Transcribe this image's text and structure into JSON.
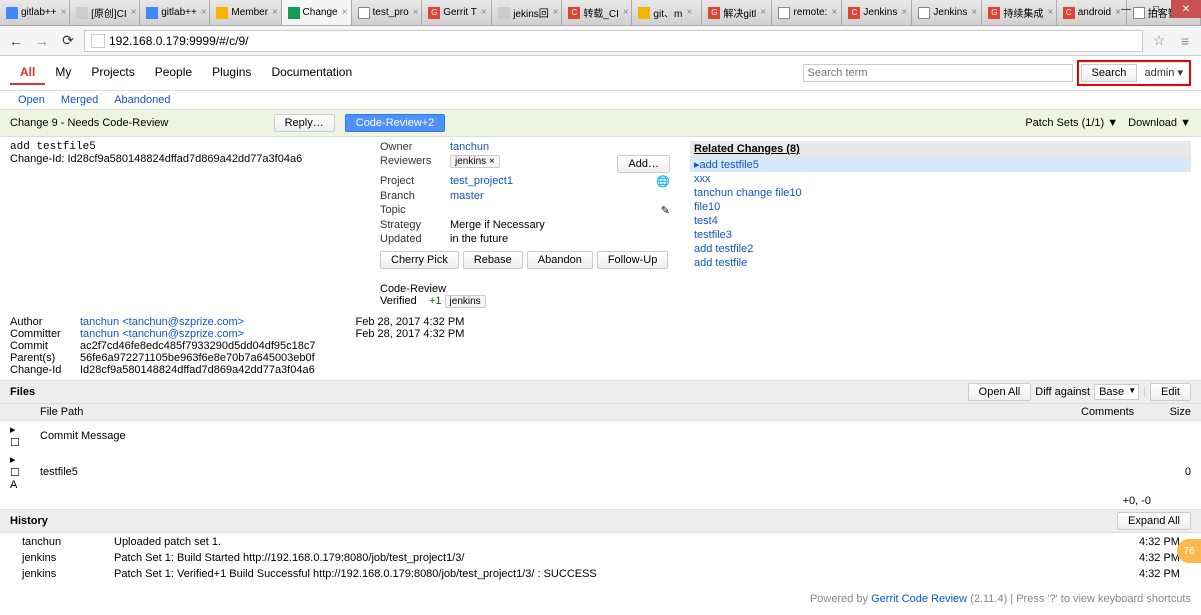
{
  "browser": {
    "tabs": [
      {
        "label": "gitlab++",
        "iconClass": "i-blue"
      },
      {
        "label": "[原创]CI",
        "iconClass": "i-gray"
      },
      {
        "label": "gitlab++",
        "iconClass": "i-blue"
      },
      {
        "label": "Member",
        "iconClass": "i-orange"
      },
      {
        "label": "Change",
        "iconClass": "i-green",
        "active": true
      },
      {
        "label": "test_pro",
        "iconClass": "i-doc"
      },
      {
        "label": "Gerrit T",
        "iconClass": "i-red",
        "badge": "G"
      },
      {
        "label": "jekins回",
        "iconClass": "i-gray"
      },
      {
        "label": "转载_CI",
        "iconClass": "i-red",
        "badge": "C"
      },
      {
        "label": "git、m",
        "iconClass": "i-orange"
      },
      {
        "label": "解决gitl",
        "iconClass": "i-red",
        "badge": "G"
      },
      {
        "label": "remote:",
        "iconClass": "i-doc"
      },
      {
        "label": "Jenkins",
        "iconClass": "i-red",
        "badge": "C"
      },
      {
        "label": "Jenkins",
        "iconClass": "i-doc"
      },
      {
        "label": "持续集成",
        "iconClass": "i-red",
        "badge": "G"
      },
      {
        "label": "android",
        "iconClass": "i-red",
        "badge": "C"
      },
      {
        "label": "拍客智能",
        "iconClass": "i-doc"
      }
    ],
    "url": "192.168.0.179:9999/#/c/9/"
  },
  "header": {
    "nav": [
      "All",
      "My",
      "Projects",
      "People",
      "Plugins",
      "Documentation"
    ],
    "activeNav": "All",
    "subnav": [
      "Open",
      "Merged",
      "Abandoned"
    ],
    "searchPlaceholder": "Search term",
    "searchBtn": "Search",
    "user": "admin ▾"
  },
  "change": {
    "barLeft": "Change 9 - Needs Code-Review",
    "subject": "add testfile5",
    "changeIdLabel": "Change-Id: ",
    "changeId": "Id28cf9a580148824dffad7d869a42dd77a3f04a6",
    "replyBtn": "Reply…",
    "crBtn": "Code-Review+2",
    "patchSets": "Patch Sets (1/1) ▼",
    "download": "Download ▼"
  },
  "info": {
    "owner": {
      "k": "Owner",
      "v": "tanchun"
    },
    "reviewers": {
      "k": "Reviewers",
      "v": "jenkins ×",
      "add": "Add…"
    },
    "project": {
      "k": "Project",
      "v": "test_project1"
    },
    "branch": {
      "k": "Branch",
      "v": "master"
    },
    "topic": {
      "k": "Topic",
      "v": ""
    },
    "strategy": {
      "k": "Strategy",
      "v": "Merge if Necessary"
    },
    "updated": {
      "k": "Updated",
      "v": "in the future"
    },
    "actions": [
      "Cherry Pick",
      "Rebase",
      "Abandon",
      "Follow-Up"
    ],
    "reviewLabel": "Code-Review",
    "verified": {
      "label": "Verified",
      "score": "+1",
      "user": "jenkins"
    }
  },
  "related": {
    "header": "Related Changes (8)",
    "items": [
      {
        "label": "add testfile5",
        "current": true
      },
      {
        "label": "xxx"
      },
      {
        "label": "tanchun change file10"
      },
      {
        "label": "file10"
      },
      {
        "label": "test4"
      },
      {
        "label": "testfile3"
      },
      {
        "label": "add testfile2"
      },
      {
        "label": "add testfile"
      }
    ]
  },
  "commit": {
    "author": {
      "k": "Author",
      "name": "tanchun",
      "email": "<tanchun@szprize.com>",
      "date": "Feb 28, 2017 4:32 PM"
    },
    "committer": {
      "k": "Committer",
      "name": "tanchun",
      "email": "<tanchun@szprize.com>",
      "date": "Feb 28, 2017 4:32 PM"
    },
    "commit": {
      "k": "Commit",
      "v": "ac2f7cd46fe8edc485f7933290d5dd04df95c18c7"
    },
    "parents": {
      "k": "Parent(s)",
      "v": "56fe6a972271105be963f6e8e70b7a645003eb0f"
    },
    "changeId": {
      "k": "Change-Id",
      "v": "Id28cf9a580148824dffad7d869a42dd77a3f04a6"
    }
  },
  "files": {
    "title": "Files",
    "openAll": "Open All",
    "diffAgainst": "Diff against",
    "base": "Base",
    "edit": "Edit",
    "cols": {
      "path": "File Path",
      "comments": "Comments",
      "size": "Size"
    },
    "rows": [
      {
        "path": "Commit Message"
      },
      {
        "mark": "A",
        "path": "testfile5",
        "size": "0"
      }
    ],
    "totals": "+0, -0"
  },
  "history": {
    "title": "History",
    "expandAll": "Expand All",
    "rows": [
      {
        "who": "tanchun",
        "msg": "Uploaded patch set 1.",
        "time": "4:32 PM"
      },
      {
        "who": "jenkins",
        "msg": "Patch Set 1: Build Started http://192.168.0.179:8080/job/test_project1/3/",
        "time": "4:32 PM"
      },
      {
        "who": "jenkins",
        "msg": "Patch Set 1: Verified+1 Build Successful http://192.168.0.179:8080/job/test_project1/3/ : SUCCESS",
        "time": "4:32 PM"
      }
    ]
  },
  "footer": {
    "prefix": "Powered by ",
    "link": "Gerrit Code Review",
    "suffix": " (2.11.4) | Press '?' to view keyboard shortcuts"
  }
}
